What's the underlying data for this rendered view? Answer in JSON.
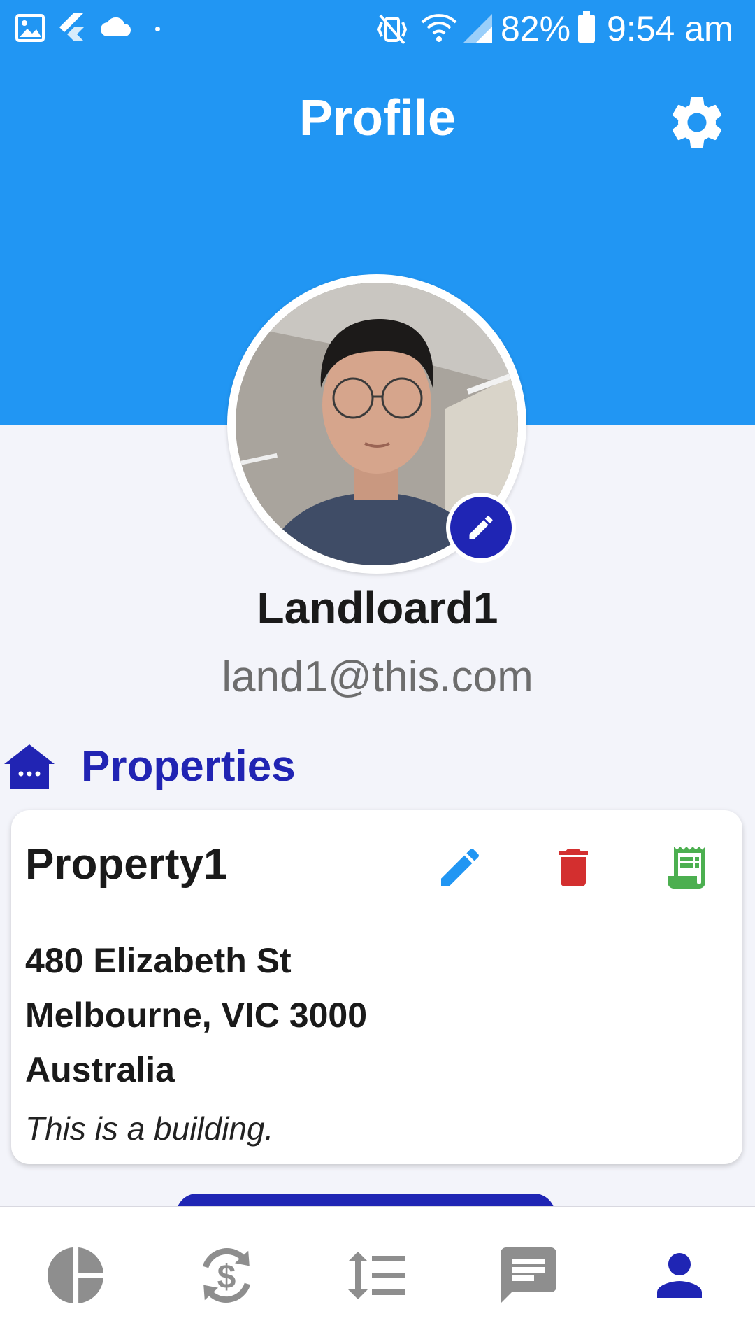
{
  "status_bar": {
    "battery": "82%",
    "time": "9:54 am"
  },
  "header": {
    "title": "Profile"
  },
  "profile": {
    "name": "Landloard1",
    "email": "land1@this.com"
  },
  "section": {
    "title": "Properties"
  },
  "property": {
    "name": "Property1",
    "address_line1": "480 Elizabeth St",
    "address_line2": "Melbourne, VIC 3000",
    "address_line3": "Australia",
    "description": "This is a building."
  },
  "colors": {
    "header": "#2196f3",
    "accent": "#1f25b4",
    "edit": "#2196f3",
    "delete": "#d32f2f",
    "receipt": "#4caf50",
    "nav_inactive": "#8e8e8e"
  },
  "bottom_nav": {
    "items": [
      "dashboard-icon",
      "payments-icon",
      "list-icon",
      "messages-icon",
      "profile-icon"
    ],
    "active": "profile-icon"
  }
}
